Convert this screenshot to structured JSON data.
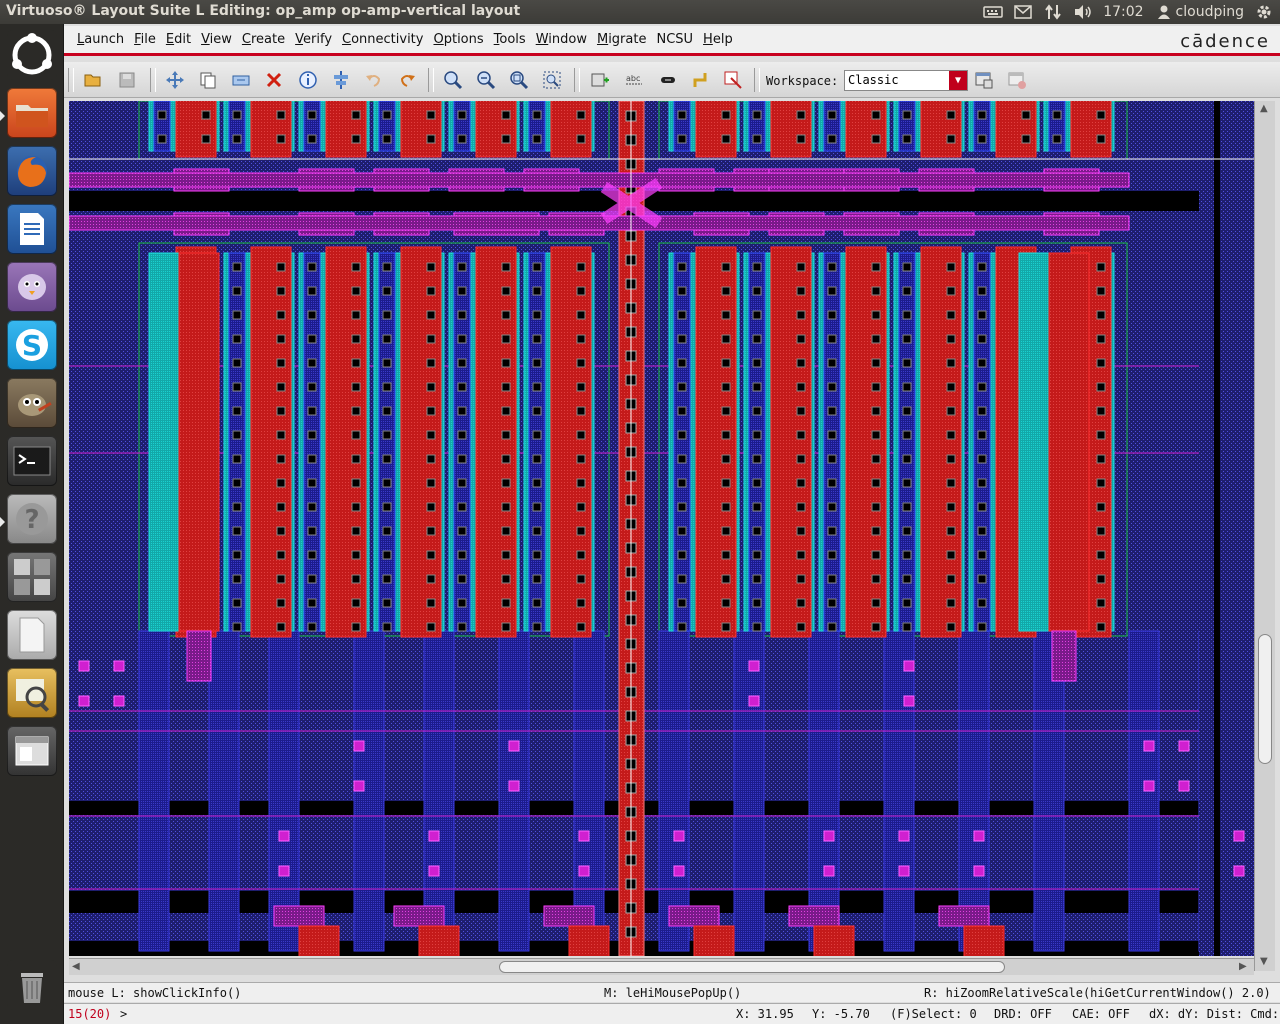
{
  "window": {
    "title": "Virtuoso® Layout Suite L Editing: op_amp op-amp-vertical layout"
  },
  "tray": {
    "time": "17:02",
    "user": "cloudping"
  },
  "launcher": {
    "items": [
      "dash-icon",
      "files-icon",
      "firefox-icon",
      "writer-icon",
      "pidgin-icon",
      "skype-icon",
      "gimp-icon",
      "terminal-icon",
      "help-icon",
      "workspace-switcher-icon",
      "document-icon",
      "image-viewer-icon",
      "window-icon",
      "trash-icon"
    ]
  },
  "menubar": {
    "items": [
      {
        "label": "Launch",
        "ul": "L",
        "rest": "aunch"
      },
      {
        "label": "File",
        "ul": "F",
        "rest": "ile"
      },
      {
        "label": "Edit",
        "ul": "E",
        "rest": "dit"
      },
      {
        "label": "View",
        "ul": "V",
        "rest": "iew"
      },
      {
        "label": "Create",
        "ul": "C",
        "rest": "reate"
      },
      {
        "label": "Verify",
        "ul": "V",
        "rest": "erify"
      },
      {
        "label": "Connectivity",
        "ul": "C",
        "rest": "onnectivity"
      },
      {
        "label": "Options",
        "ul": "O",
        "rest": "ptions"
      },
      {
        "label": "Tools",
        "ul": "T",
        "rest": "ools"
      },
      {
        "label": "Window",
        "ul": "W",
        "rest": "indow"
      },
      {
        "label": "Migrate",
        "ul": "M",
        "rest": "igrate"
      },
      {
        "label": "NCSU",
        "ul": "",
        "rest": "NCSU"
      },
      {
        "label": "Help",
        "ul": "H",
        "rest": "elp"
      }
    ],
    "brand": "cādence"
  },
  "toolbar": {
    "workspace_label": "Workspace:",
    "workspace_value": "Classic"
  },
  "status": {
    "mouse_left": "mouse L: showClickInfo()",
    "mouse_middle": "M: leHiMousePopUp()",
    "mouse_right": "R: hiZoomRelativeScale(hiGetCurrentWindow() 2.0)",
    "counter": "15(20)",
    "prompt": ">",
    "x": "X: 31.95",
    "y": "Y: -5.70",
    "select": "(F)Select: 0",
    "drd": "DRD: OFF",
    "cae": "CAE: OFF",
    "dist": "dX: dY: Dist: Cmd:"
  },
  "colors": {
    "poly": "#c01818",
    "metal1": "#2050d0",
    "diffusion": "#18a0a0",
    "contact": "#000000",
    "metal2": "#d020d0",
    "accent": "#c8001e"
  }
}
